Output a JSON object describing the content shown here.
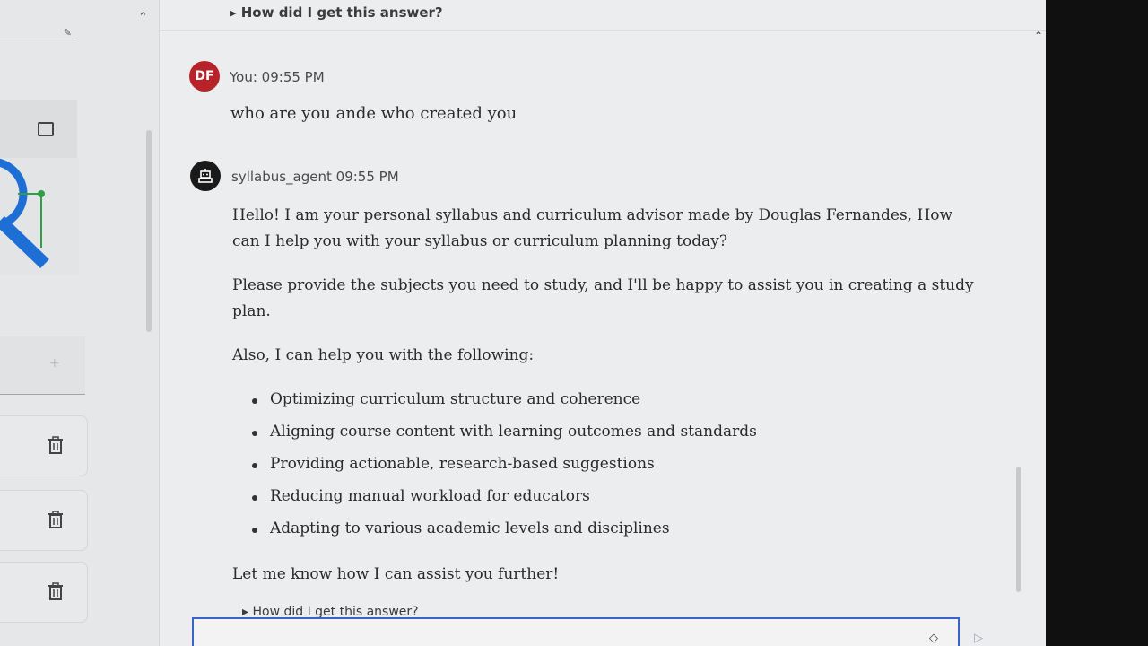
{
  "top": {
    "how_link": "▸ How did I get this answer?"
  },
  "user_message": {
    "avatar_initials": "DF",
    "meta": "You: 09:55 PM",
    "text": "who are you ande who created you"
  },
  "bot_message": {
    "meta": "syllabus_agent 09:55 PM",
    "para1": "Hello! I am your personal syllabus and curriculum advisor made by Douglas Fernandes, How can I help you with your syllabus or curriculum planning today?",
    "para2": "Please provide the subjects you need to study, and I'll be happy to assist you in creating a study plan.",
    "para3": "Also, I can help you with the following:",
    "items": [
      "Optimizing curriculum structure and coherence",
      "Aligning course content with learning outcomes and standards",
      "Providing actionable, research-based suggestions",
      "Reducing manual workload for educators",
      "Adapting to various academic levels and disciplines"
    ],
    "closing": "Let me know how I can assist you further!",
    "how_link": "▸ How did I get this answer?"
  },
  "icons": {
    "edit": "edit-icon",
    "image": "image-icon",
    "trash": "trash-icon",
    "bot": "robot-icon",
    "eraser": "eraser-icon",
    "send": "send-icon"
  },
  "colors": {
    "user_avatar": "#b8232a",
    "composer_border": "#3a62c8"
  }
}
